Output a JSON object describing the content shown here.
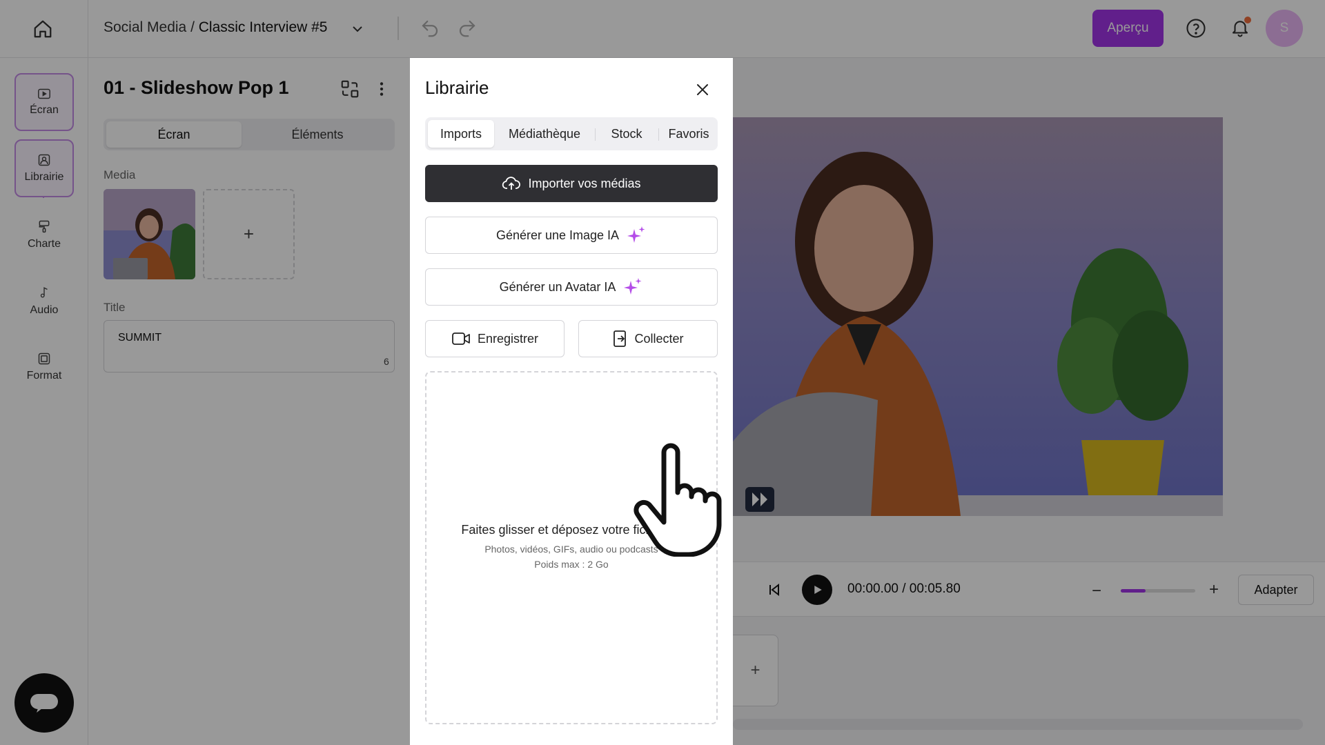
{
  "topbar": {
    "breadcrumb_parent": "Social Media",
    "breadcrumb_sep": " / ",
    "breadcrumb_current": "Classic Interview #5",
    "apercu_label": "Aperçu",
    "avatar_initial": "S"
  },
  "leftnav": {
    "items": [
      {
        "label": "Écran",
        "icon": "screen-icon"
      },
      {
        "label": "Librairie",
        "icon": "library-icon"
      },
      {
        "label": "Charte",
        "icon": "brush-icon"
      },
      {
        "label": "Audio",
        "icon": "music-note-icon"
      },
      {
        "label": "Format",
        "icon": "frame-icon"
      }
    ]
  },
  "panel": {
    "title": "01 - Slideshow Pop 1",
    "tabs": [
      "Écran",
      "Éléments"
    ],
    "active_tab": "Écran",
    "media_label": "Media",
    "add_media": "+",
    "title_label": "Title",
    "title_value": "SUMMIT",
    "title_char_count": "6"
  },
  "modal": {
    "title": "Librairie",
    "tabs": [
      "Imports",
      "Médiathèque",
      "Stock",
      "Favoris"
    ],
    "active_tab": "Imports",
    "import_button": "Importer vos médias",
    "generate_image_button": "Générer une Image IA",
    "generate_avatar_button": "Générer un Avatar IA",
    "record_button": "Enregistrer",
    "collect_button": "Collecter",
    "dropzone_title": "Faites glisser et déposez votre fichier ici",
    "dropzone_types": "Photos, vidéos, GIFs, audio ou podcasts",
    "dropzone_limit": "Poids max : 2 Go"
  },
  "player": {
    "time_display": "00:00.00 / 00:05.80",
    "zoom_level_fraction": 0.33,
    "adapter_label": "Adapter",
    "timeline_add": "+"
  },
  "colors": {
    "accent": "#a235e8",
    "sparkle": "#b44de8",
    "notification_dot": "#f06d3c",
    "dark_button": "#2f2f33"
  }
}
